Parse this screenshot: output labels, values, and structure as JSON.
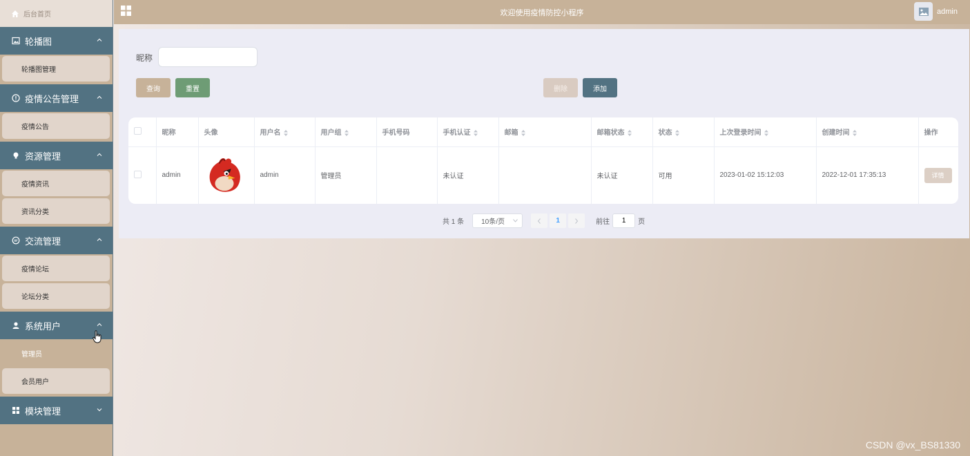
{
  "sidebar": {
    "home_label": "后台首页",
    "groups": [
      {
        "label": "轮播图",
        "items": [
          "轮播图管理"
        ]
      },
      {
        "label": "疫情公告管理",
        "items": [
          "疫情公告"
        ]
      },
      {
        "label": "资源管理",
        "items": [
          "疫情资讯",
          "资讯分类"
        ]
      },
      {
        "label": "交流管理",
        "items": [
          "疫情论坛",
          "论坛分类"
        ]
      },
      {
        "label": "系统用户",
        "items": [
          "管理员",
          "会员用户"
        ]
      },
      {
        "label": "模块管理",
        "items": []
      }
    ],
    "active_item": "管理员"
  },
  "header": {
    "title": "欢迎使用疫情防控小程序",
    "user": "admin"
  },
  "search": {
    "label": "昵称",
    "value": "",
    "query_button": "查询",
    "reset_button": "重置",
    "delete_button": "删除",
    "add_button": "添加"
  },
  "table": {
    "columns": [
      "昵称",
      "头像",
      "用户名",
      "用户组",
      "手机号码",
      "手机认证",
      "邮箱",
      "邮箱状态",
      "状态",
      "上次登录时间",
      "创建时间",
      "操作"
    ],
    "rows": [
      {
        "nickname": "admin",
        "username": "admin",
        "group": "管理员",
        "phone": "",
        "phone_verified": "未认证",
        "email": "",
        "email_status": "未认证",
        "status": "可用",
        "last_login": "2023-01-02 15:12:03",
        "created": "2022-12-01 17:35:13",
        "action": "详情"
      }
    ]
  },
  "pager": {
    "total": "共 1 条",
    "page_size": "10条/页",
    "current_page": "1",
    "goto_label": "前往",
    "goto_value": "1",
    "page_suffix": "页"
  },
  "watermark": "CSDN @vx_BS81330",
  "colors": {
    "primary_tan": "#c7b299",
    "sidebar_blue": "#527282",
    "reset_green": "#6e9c75",
    "active_page": "#409eff"
  }
}
